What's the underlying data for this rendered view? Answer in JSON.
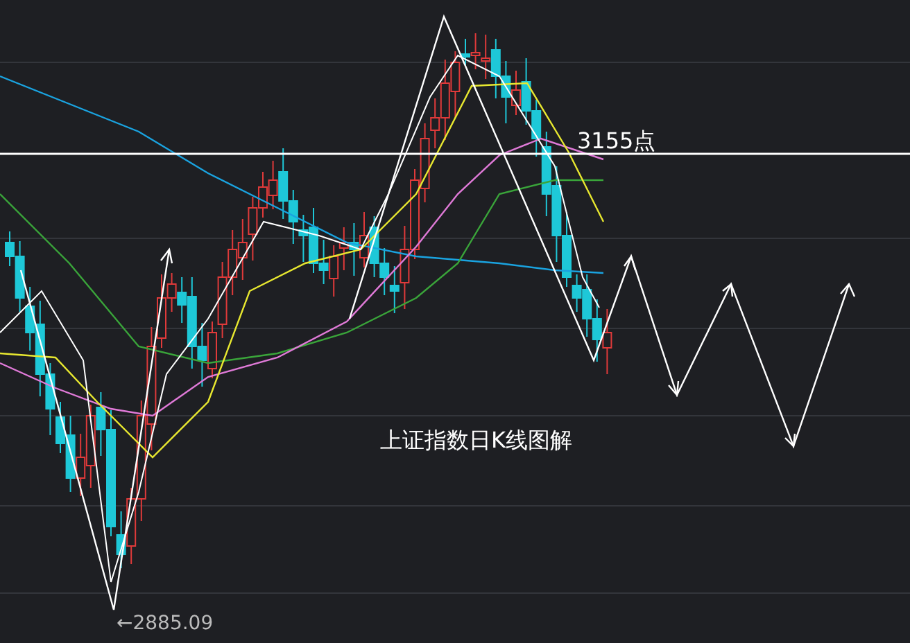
{
  "chart": {
    "price_label": "3155点",
    "title": "上证指数日K线图解",
    "low_label": "←2885.09"
  }
}
